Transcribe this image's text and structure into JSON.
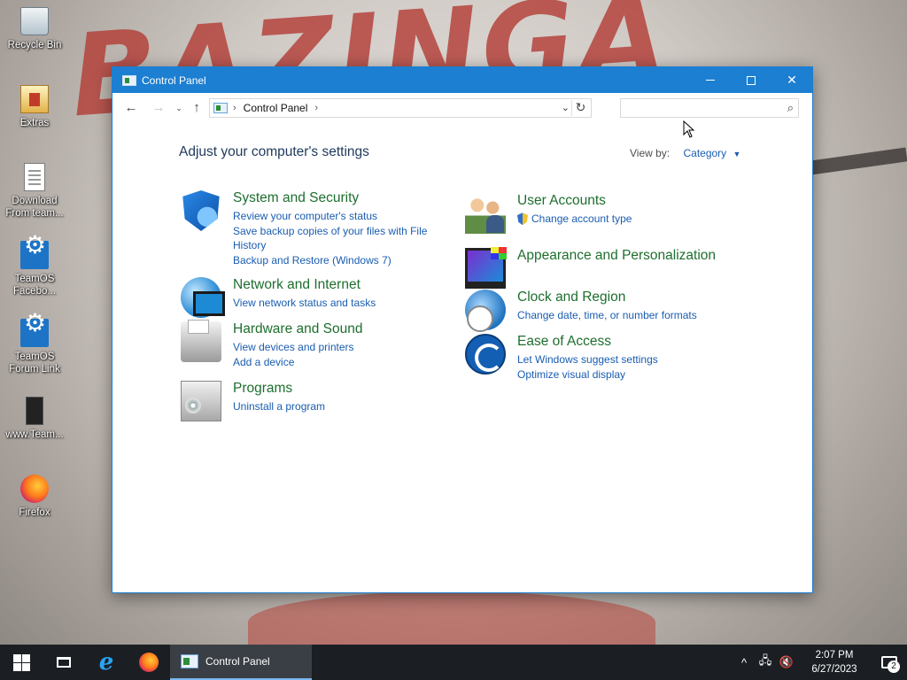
{
  "desktop": {
    "icons": [
      {
        "label": "Recycle Bin",
        "icon": "recycle-bin-icon"
      },
      {
        "label": "Extras",
        "icon": "extras-icon"
      },
      {
        "label": "Download From team...",
        "icon": "document-icon"
      },
      {
        "label": "TeamOS Facebo...",
        "icon": "teamos-gear-icon"
      },
      {
        "label": "TeamOS Forum Link",
        "icon": "teamos-gear-icon"
      },
      {
        "label": "www.Team...",
        "icon": "file-icon"
      },
      {
        "label": "Firefox",
        "icon": "firefox-icon"
      }
    ]
  },
  "window": {
    "title": "Control Panel",
    "controls": {
      "minimize": "minimize-icon",
      "maximize": "maximize-icon",
      "close": "✕"
    },
    "address": {
      "crumb": "Control Panel",
      "separator": "›"
    },
    "search": {
      "value": "",
      "placeholder": ""
    },
    "heading": "Adjust your computer's settings",
    "view_by": {
      "label": "View by:",
      "value": "Category"
    },
    "categories_left": [
      {
        "title": "System and Security",
        "links": [
          "Review your computer's status",
          "Save backup copies of your files with File History",
          "Backup and Restore (Windows 7)"
        ]
      },
      {
        "title": "Network and Internet",
        "links": [
          "View network status and tasks"
        ]
      },
      {
        "title": "Hardware and Sound",
        "links": [
          "View devices and printers",
          "Add a device"
        ]
      },
      {
        "title": "Programs",
        "links": [
          "Uninstall a program"
        ]
      }
    ],
    "categories_right": [
      {
        "title": "User Accounts",
        "links": [
          "Change account type"
        ]
      },
      {
        "title": "Appearance and Personalization",
        "links": []
      },
      {
        "title": "Clock and Region",
        "links": [
          "Change date, time, or number formats"
        ]
      },
      {
        "title": "Ease of Access",
        "links": [
          "Let Windows suggest settings",
          "Optimize visual display"
        ]
      }
    ]
  },
  "taskbar": {
    "active_app": "Control Panel",
    "time": "2:07 PM",
    "date": "6/27/2023",
    "notification_count": "2"
  }
}
